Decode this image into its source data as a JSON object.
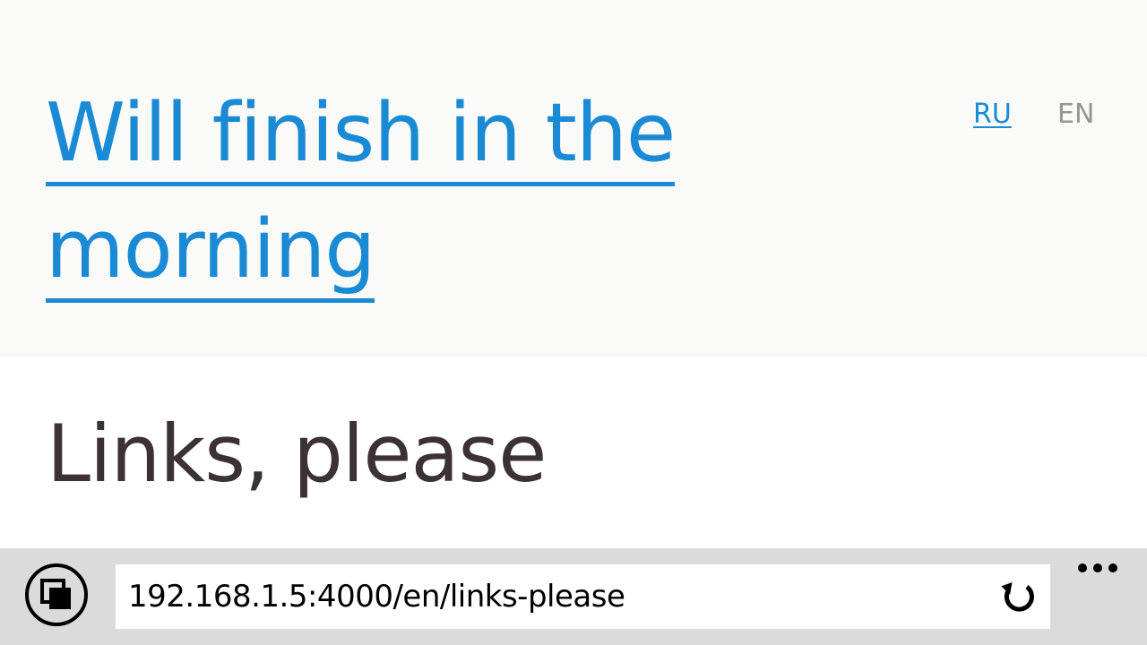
{
  "header": {
    "site_title": "Will finish in the morning",
    "languages": {
      "ru": "RU",
      "en": "EN"
    }
  },
  "main": {
    "heading": "Links, please"
  },
  "browser": {
    "address": "192.168.1.5:4000/en/links-please",
    "icons": {
      "tabs": "tabs-icon",
      "refresh": "refresh-icon",
      "more": "more-icon"
    }
  },
  "colors": {
    "accent": "#1a8ad4",
    "heading": "#3c3233",
    "header_bg": "#fafaf8",
    "inactive_lang": "#9a958c",
    "browser_bar": "#dbdbdb"
  }
}
